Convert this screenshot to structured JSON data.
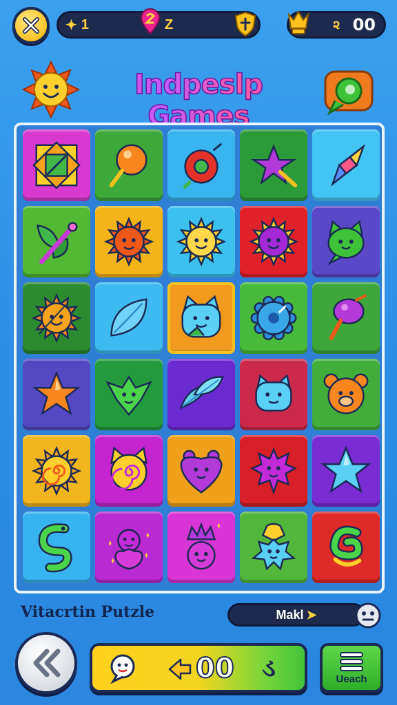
{
  "hud": {
    "lives": "1",
    "pin_value": "Z",
    "high_score_symbol": "૨",
    "score": "00"
  },
  "title": "Indpeslp Games",
  "level_name": "Vitacrtin Putzle",
  "mode_pill": {
    "label": "Makl"
  },
  "action_bar": {
    "coins": "00",
    "glyph": "ડ"
  },
  "menu_button": {
    "label": "Ueach"
  },
  "colors": {
    "background": "#2b8fe6",
    "hud_bg": "#1d2a4e",
    "accent_yellow": "#ffd23f",
    "selected_outline": "#f7c21f"
  },
  "board": {
    "columns": 5,
    "rows": 6,
    "tiles": [
      {
        "bg": "#d83ad0",
        "icon": "framed-square-icon"
      },
      {
        "bg": "#3fa83a",
        "icon": "lollipop-icon"
      },
      {
        "bg": "#38b4ef",
        "icon": "swirl-ball-icon"
      },
      {
        "bg": "#2d9a3a",
        "icon": "magic-star-icon"
      },
      {
        "bg": "#42c5f2",
        "icon": "crystal-icon"
      },
      {
        "bg": "#53b834",
        "icon": "leaf-wand-icon"
      },
      {
        "bg": "#f3b417",
        "icon": "fox-face-icon"
      },
      {
        "bg": "#3cc0ee",
        "icon": "sun-face-icon"
      },
      {
        "bg": "#e0212a",
        "icon": "purple-sun-icon"
      },
      {
        "bg": "#5a48c8",
        "icon": "green-cat-icon"
      },
      {
        "bg": "#2c8a2f",
        "icon": "orange-sun-icon"
      },
      {
        "bg": "#3dbaf0",
        "icon": "blue-leaf-icon"
      },
      {
        "bg": "#f19a1e",
        "icon": "blue-cat-icon",
        "selected": true
      },
      {
        "bg": "#48b93a",
        "icon": "blue-gear-icon"
      },
      {
        "bg": "#3ea63b",
        "icon": "purple-lollipop-icon"
      },
      {
        "bg": "#5347c2",
        "icon": "orange-star-icon"
      },
      {
        "bg": "#239a3c",
        "icon": "green-gem-icon"
      },
      {
        "bg": "#6a2ad0",
        "icon": "blue-feather-icon"
      },
      {
        "bg": "#cc2a4c",
        "icon": "blue-cat-face-icon"
      },
      {
        "bg": "#43ad3c",
        "icon": "bear-face-icon"
      },
      {
        "bg": "#f1b51d",
        "icon": "spiral-sun-icon"
      },
      {
        "bg": "#c425cf",
        "icon": "swirl-cat-icon"
      },
      {
        "bg": "#f1a01b",
        "icon": "heart-creature-icon"
      },
      {
        "bg": "#d81f27",
        "icon": "spiky-creature-icon"
      },
      {
        "bg": "#7a2cd2",
        "icon": "blue-star-icon"
      },
      {
        "bg": "#37b3ef",
        "icon": "green-snake-icon"
      },
      {
        "bg": "#b92ad2",
        "icon": "sparkle-creature-icon"
      },
      {
        "bg": "#d834d6",
        "icon": "crowned-creature-icon"
      },
      {
        "bg": "#52b63c",
        "icon": "blue-monster-icon"
      },
      {
        "bg": "#de2a28",
        "icon": "green-spiral-icon"
      }
    ]
  }
}
